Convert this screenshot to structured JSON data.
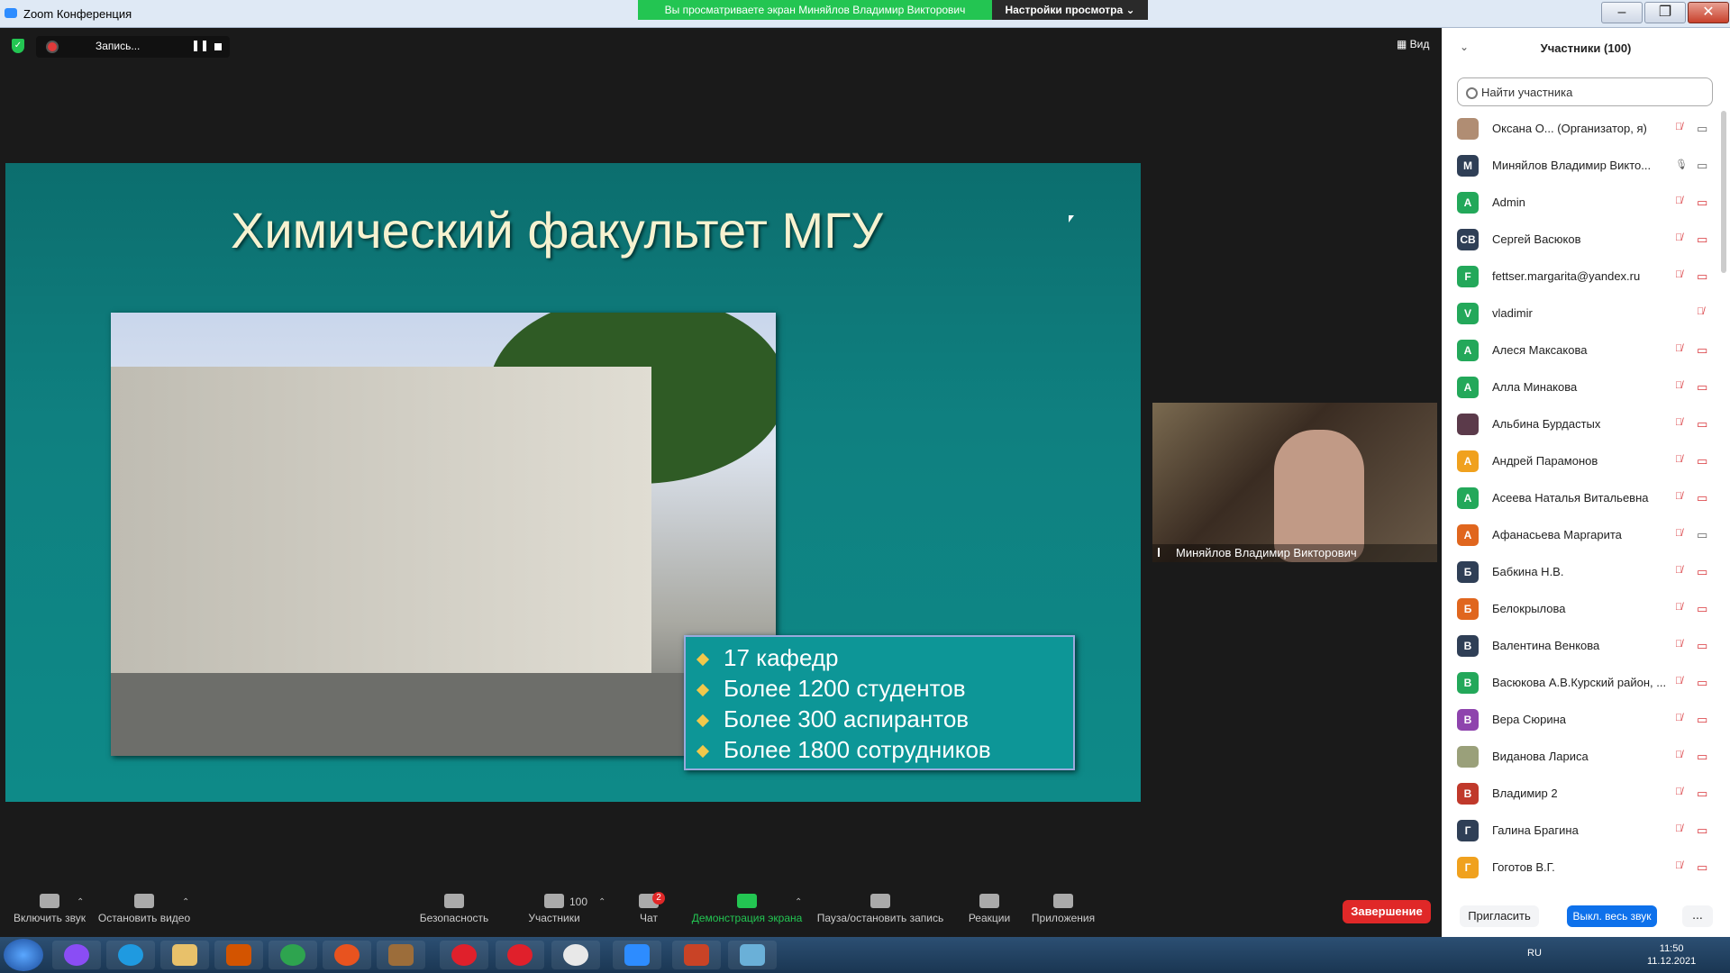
{
  "window": {
    "title": "Zoom Конференция",
    "banner": "Вы просматриваете экран Миняйлов Владимир Викторович",
    "view_options": "Настройки просмотра"
  },
  "meeting_top": {
    "recording_label": "Запись...",
    "view_label": "Вид"
  },
  "slide": {
    "title": "Химический факультет МГУ",
    "bullets": [
      "17 кафедр",
      "Более 1200 студентов",
      "Более 300 аспирантов",
      "Более 1800 сотрудников"
    ]
  },
  "video": {
    "participant_name": "Миняйлов Владимир Викторович"
  },
  "toolbar": {
    "unmute": "Включить звук",
    "stop_video": "Остановить видео",
    "security": "Безопасность",
    "participants": "Участники",
    "participants_count": "100",
    "chat": "Чат",
    "chat_badge": "2",
    "share_screen": "Демонстрация экрана",
    "pause_record": "Пауза/остановить запись",
    "reactions": "Реакции",
    "apps": "Приложения",
    "end": "Завершение"
  },
  "participants_panel": {
    "title": "Участники (100)",
    "search_placeholder": "Найти участника",
    "invite": "Пригласить",
    "mute_all": "Выкл. весь звук",
    "more": "...",
    "participants": [
      {
        "initial": "",
        "name": "Оксана О... (Организатор, я)",
        "color": "#b08d73",
        "photo": true,
        "mic": "muted",
        "cam": "on"
      },
      {
        "initial": "М",
        "name": "Миняйлов Владимир Викто...",
        "color": "#2f3f56",
        "mic": "on",
        "cam": "on"
      },
      {
        "initial": "A",
        "name": "Admin",
        "color": "#23a85a",
        "mic": "muted",
        "cam": "off"
      },
      {
        "initial": "СВ",
        "name": "Сергей Васюков",
        "color": "#2f3f56",
        "mic": "muted",
        "cam": "off"
      },
      {
        "initial": "F",
        "name": "fettser.margarita@yandex.ru",
        "color": "#23a85a",
        "mic": "muted",
        "cam": "off"
      },
      {
        "initial": "V",
        "name": "vladimir",
        "color": "#23a85a",
        "mic": "muted",
        "cam": "none"
      },
      {
        "initial": "А",
        "name": "Алеся Максакова",
        "color": "#23a85a",
        "mic": "muted",
        "cam": "off"
      },
      {
        "initial": "А",
        "name": "Алла Минакова",
        "color": "#23a85a",
        "mic": "muted",
        "cam": "off"
      },
      {
        "initial": "",
        "name": "Альбина Бурдастых",
        "color": "#5b3a4a",
        "photo": true,
        "mic": "muted",
        "cam": "off"
      },
      {
        "initial": "А",
        "name": "Андрей Парамонов",
        "color": "#f0a11e",
        "mic": "muted",
        "cam": "off"
      },
      {
        "initial": "А",
        "name": "Асеева Наталья Витальевна",
        "color": "#23a85a",
        "mic": "muted",
        "cam": "off"
      },
      {
        "initial": "А",
        "name": "Афанасьева Маргарита",
        "color": "#e0661e",
        "mic": "muted",
        "cam": "on"
      },
      {
        "initial": "Б",
        "name": "Бабкина Н.В.",
        "color": "#2f3f56",
        "mic": "muted",
        "cam": "off"
      },
      {
        "initial": "Б",
        "name": "Белокрылова",
        "color": "#e0661e",
        "mic": "muted",
        "cam": "off"
      },
      {
        "initial": "В",
        "name": "Валентина Венкова",
        "color": "#2f3f56",
        "mic": "muted",
        "cam": "off"
      },
      {
        "initial": "В",
        "name": "Васюкова А.В.Курский район, ...",
        "color": "#23a85a",
        "mic": "muted",
        "cam": "off"
      },
      {
        "initial": "В",
        "name": "Вера Сюрина",
        "color": "#8e44ad",
        "mic": "muted",
        "cam": "off"
      },
      {
        "initial": "",
        "name": "Виданова Лариса",
        "color": "#9aa07a",
        "photo": true,
        "mic": "muted",
        "cam": "off"
      },
      {
        "initial": "В",
        "name": "Владимир 2",
        "color": "#c0392b",
        "mic": "muted",
        "cam": "off"
      },
      {
        "initial": "Г",
        "name": "Галина Брагина",
        "color": "#2f3f56",
        "mic": "muted",
        "cam": "off"
      },
      {
        "initial": "Г",
        "name": "Гоготов В.Г.",
        "color": "#f0a11e",
        "mic": "muted",
        "cam": "off"
      }
    ]
  },
  "taskbar": {
    "lang": "RU",
    "time": "11:50",
    "date": "11.12.2021"
  }
}
